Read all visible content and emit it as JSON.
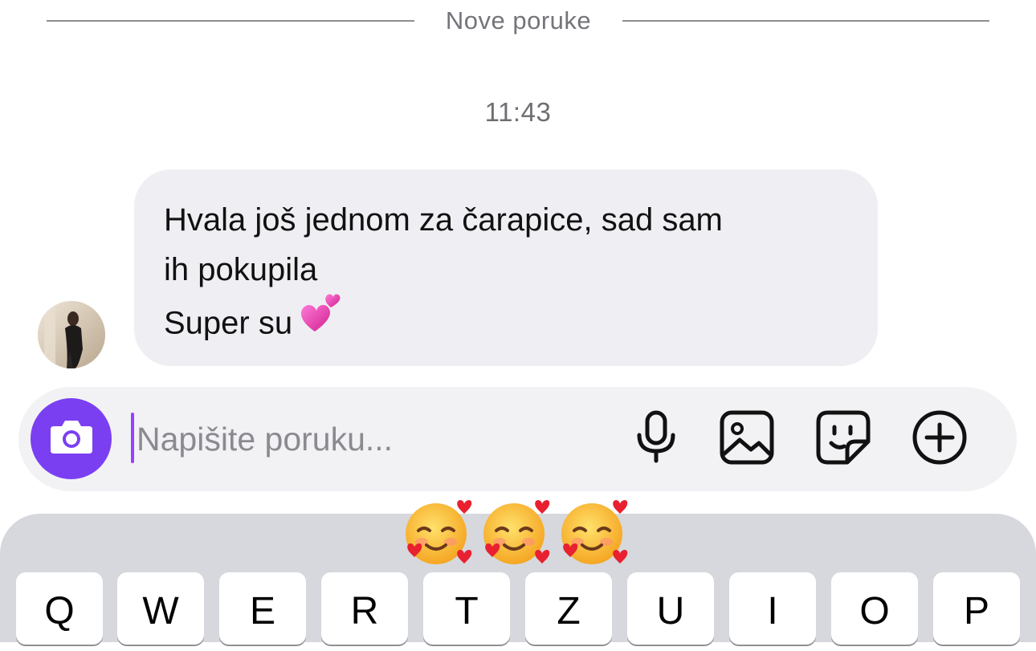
{
  "divider": {
    "label": "Nove poruke"
  },
  "timestamp": "11:43",
  "message": {
    "lines": [
      "Hvala još jednom za čarapice, sad sam",
      "ih pokupila",
      "Super su"
    ],
    "emoji": "two-hearts"
  },
  "composer": {
    "placeholder": "Napišite poruku...",
    "icons": [
      "camera-icon",
      "microphone-icon",
      "gallery-icon",
      "sticker-icon",
      "plus-icon"
    ]
  },
  "colors": {
    "accent": "#7b3ff2",
    "bubble": "#efeff3",
    "caret": "#9a40ff"
  },
  "keyboard": {
    "suggestions": [
      "smiling-face-with-hearts",
      "smiling-face-with-hearts",
      "smiling-face-with-hearts"
    ],
    "keys": [
      "Q",
      "W",
      "E",
      "R",
      "T",
      "Z",
      "U",
      "I",
      "O",
      "P"
    ]
  }
}
